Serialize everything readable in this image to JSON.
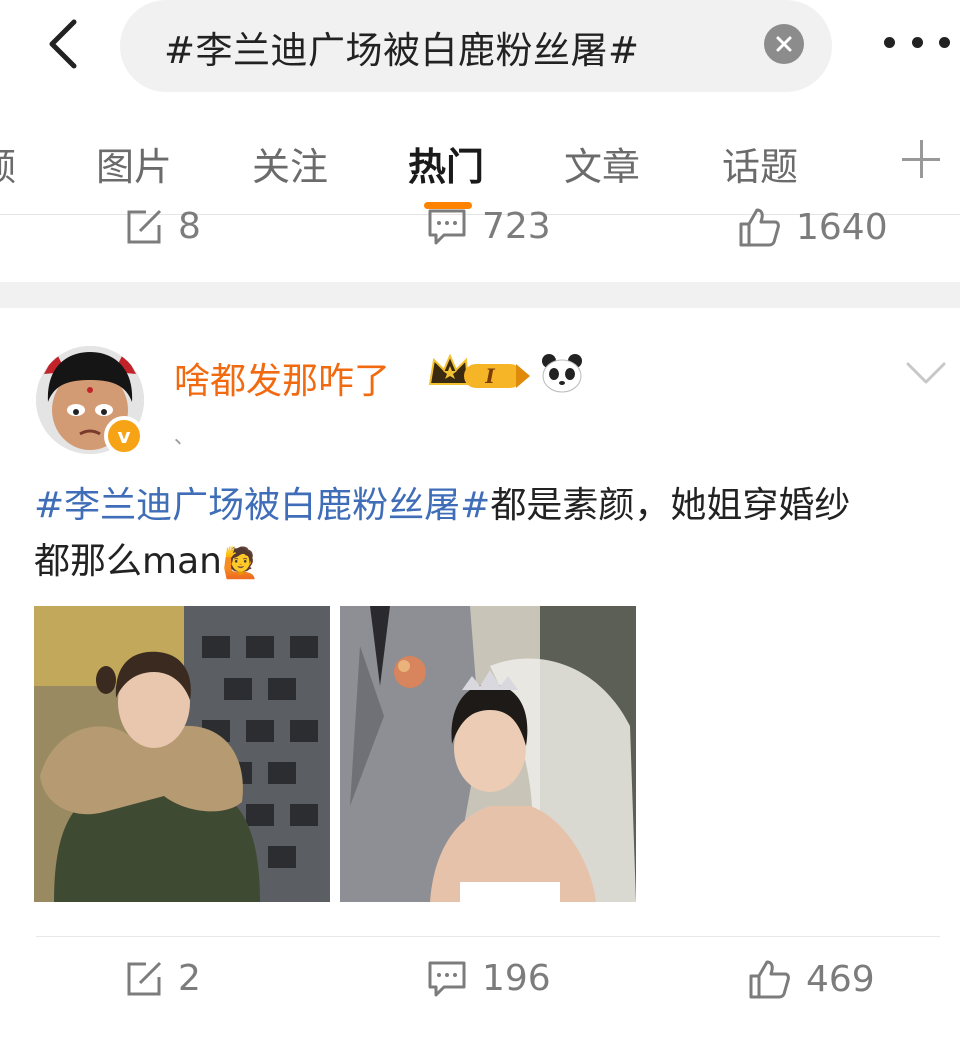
{
  "search": {
    "query": "#李兰迪广场被白鹿粉丝屠#"
  },
  "tabs": [
    {
      "label": "频"
    },
    {
      "label": "图片"
    },
    {
      "label": "关注"
    },
    {
      "label": "热门"
    },
    {
      "label": "文章"
    },
    {
      "label": "话题"
    }
  ],
  "active_tab": "热门",
  "prev_post": {
    "reposts": "8",
    "comments": "723",
    "likes": "1640"
  },
  "post": {
    "username": "啥都发那咋了",
    "badge_level": "I",
    "verify_mark": "v",
    "meta": "、",
    "text_topic": "#李兰迪广场被白鹿粉丝屠#",
    "text_body_1": "都是素颜，她姐穿婚纱",
    "text_body_2": "都那么man",
    "emoji": "🙋",
    "reposts": "2",
    "comments": "196",
    "likes": "469"
  },
  "colors": {
    "accent_orange": "#ff8200",
    "username_orange": "#f26a10",
    "topic_blue": "#3f6db8",
    "verify_gold": "#f6a316"
  },
  "icons": [
    "back-arrow-icon",
    "clear-icon",
    "more-icon",
    "add-tab-icon",
    "repost-icon",
    "comment-icon",
    "like-icon",
    "chevron-down-icon",
    "crown-icon",
    "panda-icon"
  ]
}
